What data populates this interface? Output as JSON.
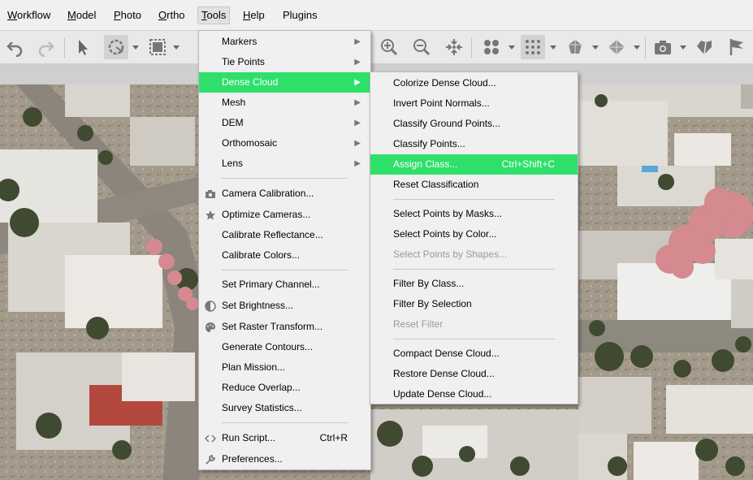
{
  "menubar": {
    "items": [
      {
        "label": "Workflow",
        "u": "W"
      },
      {
        "label": "Model",
        "u": "M"
      },
      {
        "label": "Photo",
        "u": "P"
      },
      {
        "label": "Ortho",
        "u": "O"
      },
      {
        "label": "Tools",
        "u": "T"
      },
      {
        "label": "Help",
        "u": "H"
      },
      {
        "label": "Plugins",
        "u": ""
      }
    ]
  },
  "toolbar": {
    "icons": [
      "undo-icon",
      "redo-icon",
      "pointer-icon",
      "rotate-selection-icon",
      "rectangle-selection-icon",
      "zoom-in-icon",
      "zoom-out-icon",
      "reset-view-icon",
      "point-cloud-icon",
      "dense-cloud-icon",
      "mesh-icon",
      "tiled-model-icon",
      "camera-icon",
      "shape-icon",
      "marker-flag-icon"
    ]
  },
  "tools_menu": {
    "items": [
      {
        "label": "Markers",
        "submenu": true
      },
      {
        "label": "Tie Points",
        "submenu": true
      },
      {
        "label": "Dense Cloud",
        "submenu": true,
        "highlighted": true
      },
      {
        "label": "Mesh",
        "submenu": true
      },
      {
        "label": "DEM",
        "submenu": true
      },
      {
        "label": "Orthomosaic",
        "submenu": true
      },
      {
        "label": "Lens",
        "submenu": true
      },
      {
        "label": "Camera Calibration...",
        "icon": "camera-calibration-icon"
      },
      {
        "label": "Optimize Cameras...",
        "icon": "star-icon"
      },
      {
        "label": "Calibrate Reflectance..."
      },
      {
        "label": "Calibrate Colors..."
      },
      {
        "label": "Set Primary Channel..."
      },
      {
        "label": "Set Brightness...",
        "icon": "brightness-icon"
      },
      {
        "label": "Set Raster Transform...",
        "icon": "palette-icon"
      },
      {
        "label": "Generate Contours..."
      },
      {
        "label": "Plan Mission..."
      },
      {
        "label": "Reduce Overlap..."
      },
      {
        "label": "Survey Statistics..."
      },
      {
        "label": "Run Script...",
        "shortcut": "Ctrl+R",
        "icon": "script-icon"
      },
      {
        "label": "Preferences...",
        "icon": "wrench-icon"
      }
    ]
  },
  "dense_cloud_menu": {
    "items": [
      {
        "label": "Colorize Dense Cloud..."
      },
      {
        "label": "Invert Point Normals..."
      },
      {
        "label": "Classify Ground Points..."
      },
      {
        "label": "Classify Points..."
      },
      {
        "label": "Assign Class...",
        "shortcut": "Ctrl+Shift+C",
        "highlighted": true
      },
      {
        "label": "Reset Classification"
      },
      {
        "label": "Select Points by Masks..."
      },
      {
        "label": "Select Points by Color..."
      },
      {
        "label": "Select Points by Shapes...",
        "disabled": true
      },
      {
        "label": "Filter By Class..."
      },
      {
        "label": "Filter By Selection"
      },
      {
        "label": "Reset Filter",
        "disabled": true
      },
      {
        "label": "Compact Dense Cloud..."
      },
      {
        "label": "Restore Dense Cloud..."
      },
      {
        "label": "Update Dense Cloud..."
      }
    ]
  },
  "colors": {
    "highlight": "#2ee06a",
    "menu_bg": "#f0f0f0",
    "classified_points": "#d48a8f"
  }
}
